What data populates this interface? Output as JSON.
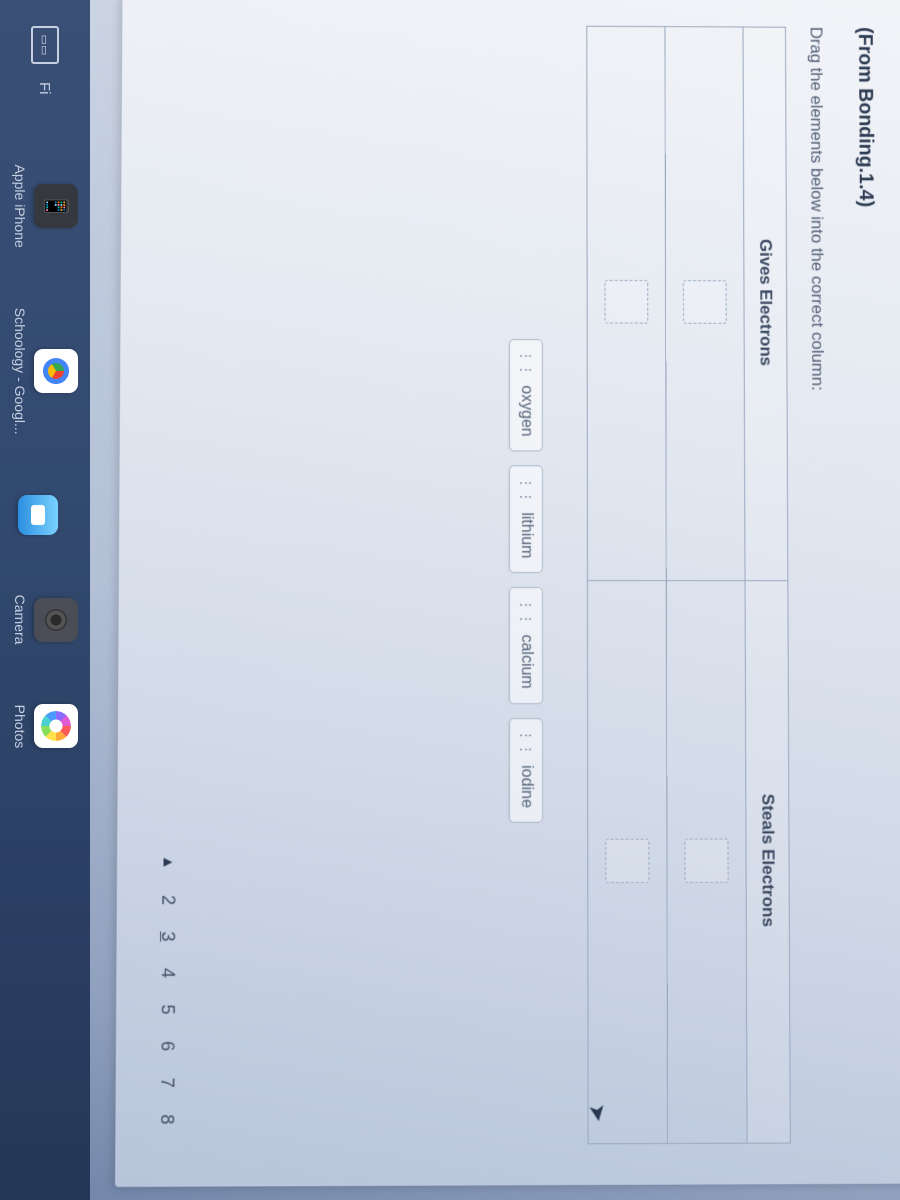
{
  "question": {
    "source_ref": "(From Bonding.1.4)",
    "instruction": "Drag the elements below into the correct column:",
    "columns": {
      "left": "Gives Electrons",
      "right": "Steals Electrons"
    }
  },
  "draggables": [
    "oxygen",
    "lithium",
    "calcium",
    "iodine"
  ],
  "pager": {
    "arrow": "▲",
    "numbers": [
      "2",
      "3",
      "4",
      "5",
      "6",
      "7",
      "8"
    ]
  },
  "dock": {
    "left_indicator": "Fi",
    "apps": {
      "phone": "Apple iPhone",
      "chrome": "Schoology - Googl...",
      "facetime": "",
      "camera": "Camera",
      "photos": "Photos"
    }
  }
}
